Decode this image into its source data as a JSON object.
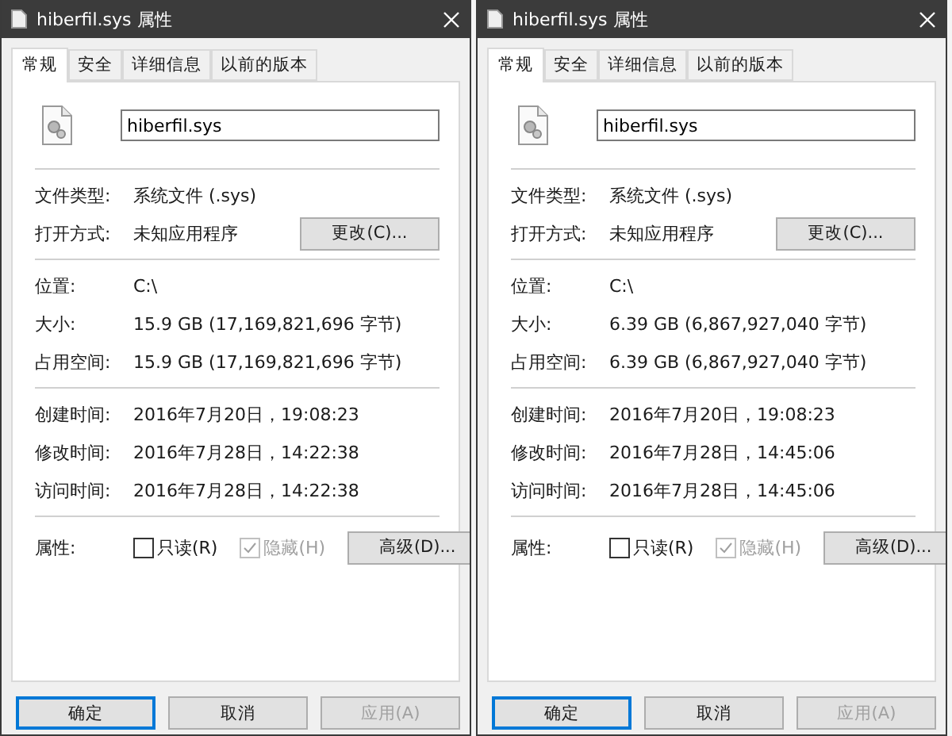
{
  "dialogs": [
    {
      "title": "hiberfil.sys 属性",
      "tabs": [
        {
          "label": "常规",
          "selected": true
        },
        {
          "label": "安全",
          "selected": false
        },
        {
          "label": "详细信息",
          "selected": false
        },
        {
          "label": "以前的版本",
          "selected": false
        }
      ],
      "filename": "hiberfil.sys",
      "sections": [
        [
          {
            "label": "文件类型:",
            "value": "系统文件 (.sys)"
          },
          {
            "label": "打开方式:",
            "value": "未知应用程序",
            "button": "更改(C)..."
          }
        ],
        [
          {
            "label": "位置:",
            "value": "C:\\"
          },
          {
            "label": "大小:",
            "value": "15.9 GB (17,169,821,696 字节)"
          },
          {
            "label": "占用空间:",
            "value": "15.9 GB (17,169,821,696 字节)"
          }
        ],
        [
          {
            "label": "创建时间:",
            "value": "2016年7月20日，19:08:23"
          },
          {
            "label": "修改时间:",
            "value": "2016年7月28日，14:22:38"
          },
          {
            "label": "访问时间:",
            "value": "2016年7月28日，14:22:38"
          }
        ]
      ],
      "attributes": {
        "label": "属性:",
        "checkboxes": [
          {
            "label": "只读(R)",
            "checked": false,
            "disabled": false
          },
          {
            "label": "隐藏(H)",
            "checked": true,
            "disabled": true
          }
        ],
        "button": "高级(D)..."
      },
      "buttons": [
        {
          "label": "确定",
          "primary": true,
          "disabled": false
        },
        {
          "label": "取消",
          "primary": false,
          "disabled": false
        },
        {
          "label": "应用(A)",
          "primary": false,
          "disabled": true
        }
      ]
    },
    {
      "title": "hiberfil.sys 属性",
      "tabs": [
        {
          "label": "常规",
          "selected": true
        },
        {
          "label": "安全",
          "selected": false
        },
        {
          "label": "详细信息",
          "selected": false
        },
        {
          "label": "以前的版本",
          "selected": false
        }
      ],
      "filename": "hiberfil.sys",
      "sections": [
        [
          {
            "label": "文件类型:",
            "value": "系统文件 (.sys)"
          },
          {
            "label": "打开方式:",
            "value": "未知应用程序",
            "button": "更改(C)..."
          }
        ],
        [
          {
            "label": "位置:",
            "value": "C:\\"
          },
          {
            "label": "大小:",
            "value": "6.39 GB (6,867,927,040 字节)"
          },
          {
            "label": "占用空间:",
            "value": "6.39 GB (6,867,927,040 字节)"
          }
        ],
        [
          {
            "label": "创建时间:",
            "value": "2016年7月20日，19:08:23"
          },
          {
            "label": "修改时间:",
            "value": "2016年7月28日，14:45:06"
          },
          {
            "label": "访问时间:",
            "value": "2016年7月28日，14:45:06"
          }
        ]
      ],
      "attributes": {
        "label": "属性:",
        "checkboxes": [
          {
            "label": "只读(R)",
            "checked": false,
            "disabled": false
          },
          {
            "label": "隐藏(H)",
            "checked": true,
            "disabled": true
          }
        ],
        "button": "高级(D)..."
      },
      "buttons": [
        {
          "label": "确定",
          "primary": true,
          "disabled": false
        },
        {
          "label": "取消",
          "primary": false,
          "disabled": false
        },
        {
          "label": "应用(A)",
          "primary": false,
          "disabled": true
        }
      ]
    }
  ]
}
